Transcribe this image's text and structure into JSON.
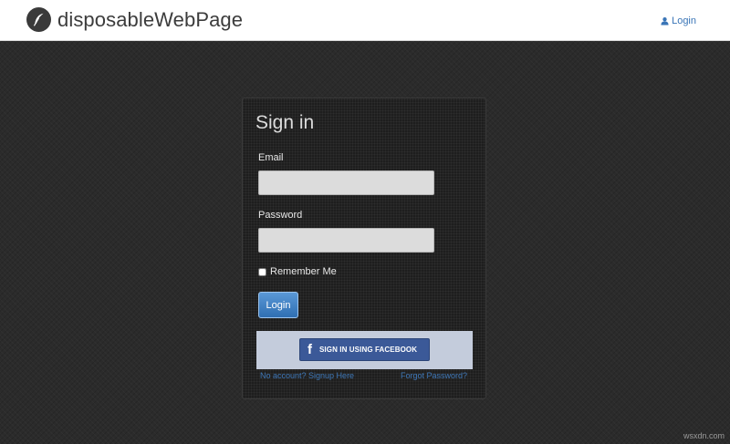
{
  "header": {
    "brand_name": "disposableWebPage",
    "brand_icon": "feather-icon",
    "login_link": "Login",
    "login_icon": "user-icon"
  },
  "signin": {
    "title": "Sign in",
    "email_label": "Email",
    "email_value": "",
    "password_label": "Password",
    "password_value": "",
    "remember_label": "Remember Me",
    "remember_checked": false,
    "login_button": "Login",
    "facebook_icon": "f",
    "facebook_button": "SIGN IN USING FACEBOOK",
    "signup_link": "No account? Signup Here",
    "forgot_link": "Forgot Password?"
  },
  "watermark": "wsxdn.com",
  "colors": {
    "accent": "#3a75b7",
    "facebook": "#3b5998",
    "background": "#2b2b2b"
  }
}
